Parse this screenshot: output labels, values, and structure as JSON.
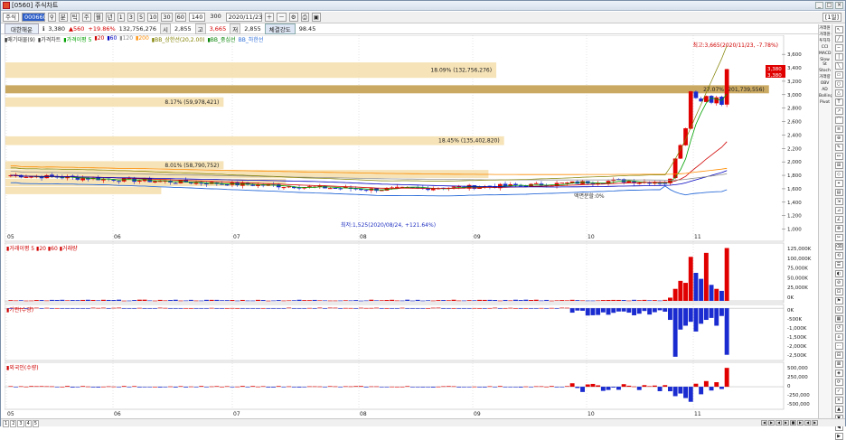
{
  "window": {
    "title": "[0560] 주식차트"
  },
  "toolbar": {
    "market": "주식",
    "code": "000660",
    "period_buttons": [
      "분",
      "틱",
      "주",
      "월",
      "년"
    ],
    "unit_buttons": [
      "1",
      "3",
      "5",
      "10",
      "30",
      "60"
    ],
    "count_value": "140",
    "count_total": "300",
    "date_value": "2020/11/23",
    "right_tag": "[1일]"
  },
  "quote": {
    "name": "대한해운",
    "price": "3,380",
    "change": "▲560",
    "change_rate": "+19.86%",
    "volume": "132,756,276",
    "open_label": "시",
    "open": "2,855",
    "high_label": "고",
    "high": "3,665",
    "low_label": "저",
    "low": "2,855",
    "button_label": "체결강도",
    "strength": "98.45"
  },
  "legend": {
    "items": [
      {
        "text": "▮매기대물(9)",
        "color": "#333333"
      },
      {
        "text": "▮가격차트",
        "color": "#333333"
      },
      {
        "text": "▮가격이평 5",
        "color": "#00a000"
      },
      {
        "text": "▮20",
        "color": "#d00000"
      },
      {
        "text": "▮60",
        "color": "#0000c0"
      },
      {
        "text": "▮120",
        "color": "#909090"
      },
      {
        "text": "▮200",
        "color": "#ff8c00"
      },
      {
        "text": "▮BB_상한선(20,2.00)",
        "color": "#808000"
      },
      {
        "text": "▮BB_중심선",
        "color": "#008000"
      },
      {
        "text": "BB_하한선",
        "color": "#2b6cd8"
      }
    ]
  },
  "chart_data": [
    {
      "type": "candlestick",
      "title": "가격차트",
      "x_ticks": [
        "05",
        "06",
        "07",
        "08",
        "09",
        "10",
        "11"
      ],
      "y_ticks": [
        "3,600",
        "3,400",
        "3,200",
        "3,000",
        "2,800",
        "2,600",
        "2,400",
        "2,200",
        "2,000",
        "1,800",
        "1,600",
        "1,400",
        "1,200",
        "1,000"
      ],
      "ylim": [
        900,
        3750
      ],
      "annotations": [
        {
          "text": "최고:3,665(2020/11/23, -7.78%)",
          "color": "#d00000"
        },
        {
          "text": "최저:1,525(2020/08/24, +121.64%)",
          "color": "#2030c0"
        },
        {
          "text": "액면분할:0%",
          "color": "#333333"
        }
      ],
      "price_labels": [
        {
          "text": "3,380",
          "color": "#d00000"
        },
        {
          "text": "3,380",
          "color": "#d00000"
        }
      ],
      "volume_profile": [
        {
          "label": "18.09% (132,756,276)",
          "price_from": 3250,
          "price_to": 3480,
          "pct": 0.63
        },
        {
          "label": "27.07% (201,739,556)",
          "price_from": 3020,
          "price_to": 3140,
          "pct": 0.98
        },
        {
          "label": "8.17% (59,978,421)",
          "price_from": 2820,
          "price_to": 2960,
          "pct": 0.28
        },
        {
          "label": "18.45% (135,402,820)",
          "price_from": 2250,
          "price_to": 2380,
          "pct": 0.64
        },
        {
          "label": "8.01% (58,790,752)",
          "price_from": 1890,
          "price_to": 2010,
          "pct": 0.28
        },
        {
          "label": "",
          "price_from": 1760,
          "price_to": 1880,
          "pct": 0.62
        },
        {
          "label": "",
          "price_from": 1640,
          "price_to": 1750,
          "pct": 0.36
        },
        {
          "label": "",
          "price_from": 1520,
          "price_to": 1630,
          "pct": 0.2
        }
      ]
    },
    {
      "type": "bar",
      "title": "거래량",
      "legend_text": "▮거래이평 5 ▮20 ▮60 ▮거래량",
      "y_ticks": [
        "125,000K",
        "100,000K",
        "75,000K",
        "50,000K",
        "25,000K",
        "0K"
      ],
      "ylim": [
        0,
        140000
      ]
    },
    {
      "type": "bar",
      "title": "기관(수량)",
      "legend_text": "▮기관(수량)",
      "y_ticks": [
        "0K",
        "-500K",
        "-1,000K",
        "-1,500K",
        "-2,000K",
        "-2,500K"
      ],
      "ylim": [
        -2600,
        100
      ]
    },
    {
      "type": "bar",
      "title": "외국인(수량)",
      "legend_text": "▮외국인(수량)",
      "y_ticks": [
        "500,000",
        "250,000",
        "0",
        "-250,000",
        "-500,000"
      ],
      "ylim": [
        -550000,
        600000
      ]
    }
  ],
  "right_panel": {
    "labels": [
      "거래원",
      "거래원",
      "투자자",
      "CCI",
      "MACD",
      "Slow St",
      "Stoch",
      "거래량",
      "OBV",
      "AD",
      "Bollinger",
      "Pivot"
    ]
  },
  "status": {
    "tabs": [
      "1",
      "2",
      "3",
      "4",
      "5"
    ],
    "nav": [
      "◀",
      "▶",
      "◀",
      "▶",
      "■",
      "▶",
      "◀",
      "▶"
    ]
  }
}
